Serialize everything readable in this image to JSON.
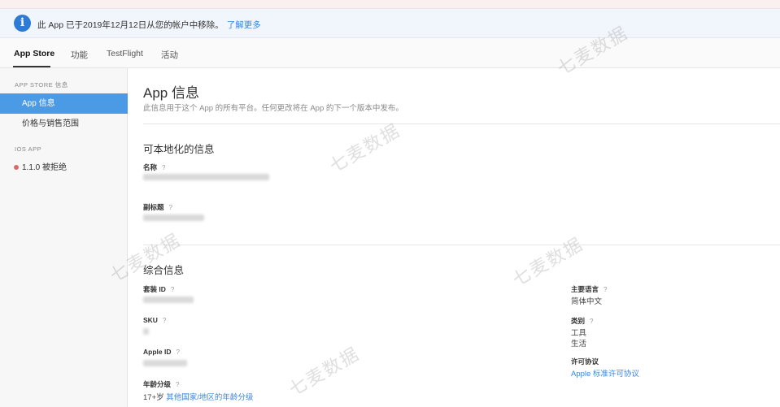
{
  "banner": {
    "icon": "info-icon",
    "icon_glyph": "i",
    "message": "此 App 已于2019年12月12日从您的帐户中移除。",
    "link": "了解更多",
    "color": "#2d7bd6"
  },
  "tabs": [
    {
      "label": "App Store",
      "active": true
    },
    {
      "label": "功能"
    },
    {
      "label": "TestFlight"
    },
    {
      "label": "活动"
    }
  ],
  "sidebar": {
    "section1": "APP STORE 信息",
    "items": [
      {
        "label": "App 信息",
        "active": true
      },
      {
        "label": "价格与销售范围"
      }
    ],
    "section2": "IOS APP",
    "version": {
      "label": "1.1.0 被拒绝",
      "status_color": "#d96a6a"
    }
  },
  "main": {
    "title": "App 信息",
    "description": "此信息用于这个 App 的所有平台。任何更改将在 App 的下一个版本中发布。",
    "localizable": {
      "heading": "可本地化的信息",
      "name_label": "名称",
      "subtitle_label": "副标题"
    },
    "general": {
      "heading": "综合信息",
      "bundle_label": "套装 ID",
      "sku_label": "SKU",
      "apple_id_label": "Apple ID",
      "age_label": "年龄分级",
      "age_value": "17+岁",
      "age_link": "其他国家/地区的年龄分级",
      "language_label": "主要语言",
      "language_value": "简体中文",
      "category_label": "类别",
      "category_primary": "工具",
      "category_secondary": "生活",
      "license_label": "许可协议",
      "license_link": "Apple 标准许可协议"
    },
    "help_glyph": "?"
  },
  "watermark": "七麦数据"
}
